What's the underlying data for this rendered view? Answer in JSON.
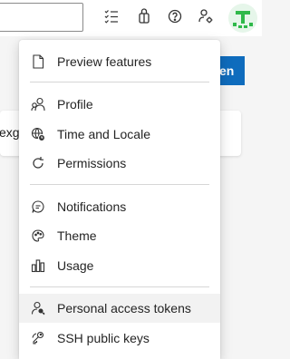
{
  "background": {
    "primary_button_label": "en",
    "card_text": "exg",
    "card_close_glyph": "‹"
  },
  "topbar": {
    "icons": [
      "list-check-icon",
      "marketplace-bag-icon",
      "help-icon",
      "user-settings-icon"
    ],
    "avatar_color": "#2fb94a"
  },
  "menu": {
    "items": [
      {
        "label": "Preview features",
        "icon": "document-icon"
      },
      {
        "label": "Profile",
        "icon": "profile-icon"
      },
      {
        "label": "Time and Locale",
        "icon": "globe-clock-icon"
      },
      {
        "label": "Permissions",
        "icon": "refresh-icon"
      },
      {
        "label": "Notifications",
        "icon": "chat-icon"
      },
      {
        "label": "Theme",
        "icon": "palette-icon"
      },
      {
        "label": "Usage",
        "icon": "bar-chart-icon"
      },
      {
        "label": "Personal access tokens",
        "icon": "person-key-icon"
      },
      {
        "label": "SSH public keys",
        "icon": "key-multiple-icon"
      }
    ]
  },
  "colors": {
    "accent": "#0f6cbd",
    "hover": "#f2f2f2"
  }
}
